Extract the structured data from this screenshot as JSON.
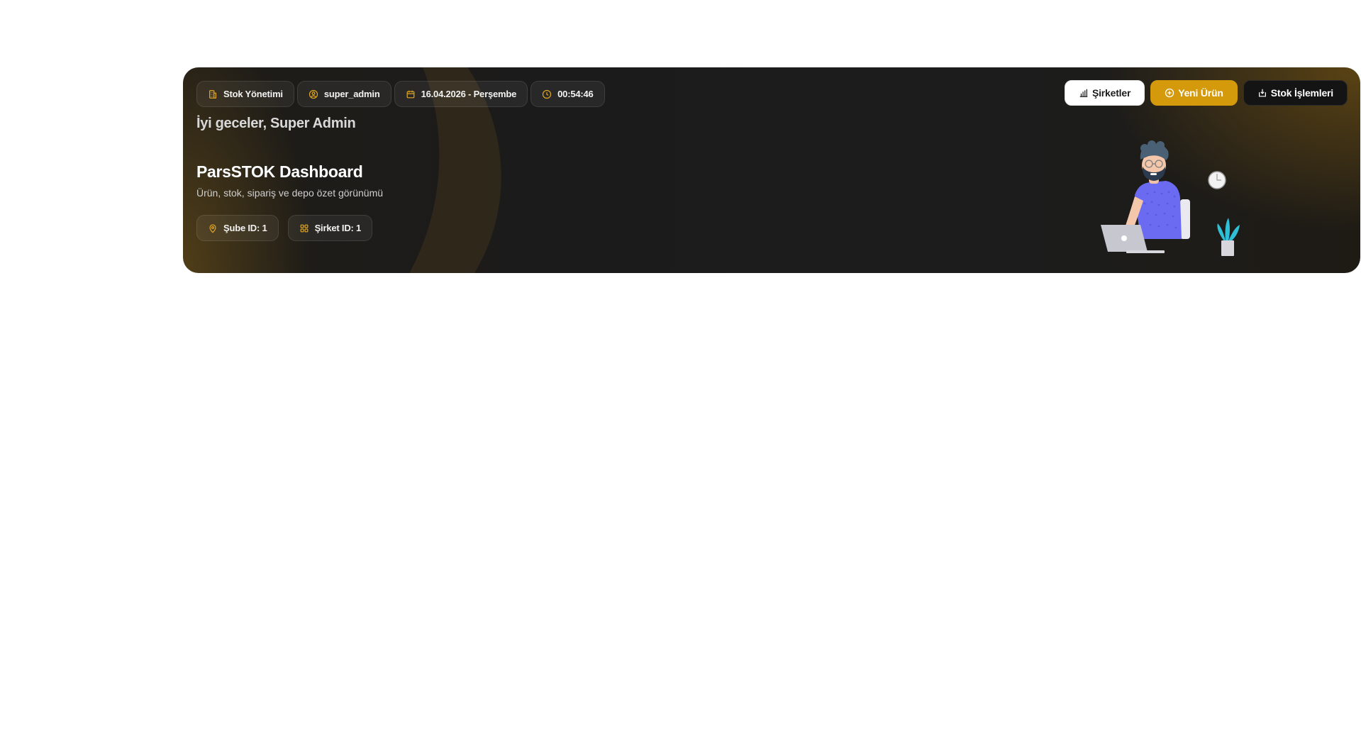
{
  "header": {
    "chips": [
      {
        "icon": "building-icon",
        "label": "Stok Yönetimi"
      },
      {
        "icon": "user-circle-icon",
        "label": "super_admin"
      },
      {
        "icon": "calendar-icon",
        "label": "16.04.2026 - Perşembe"
      },
      {
        "icon": "clock-icon",
        "label": "00:54:46"
      }
    ],
    "greeting": "İyi geceler, Super Admin",
    "title": "ParsSTOK Dashboard",
    "subtitle": "Ürün, stok, sipariş ve depo özet görünümü",
    "info_chips": [
      {
        "icon": "location-pin-icon",
        "label": "Şube ID: 1"
      },
      {
        "icon": "grid-icon",
        "label": "Şirket ID: 1"
      }
    ]
  },
  "actions": {
    "companies": {
      "icon": "bar-chart-icon",
      "label": "Şirketler"
    },
    "new_product": {
      "icon": "plus-circle-icon",
      "label": "Yeni Ürün"
    },
    "stock_ops": {
      "icon": "inbox-down-icon",
      "label": "Stok İşlemleri"
    }
  },
  "colors": {
    "accent": "#d49a0c",
    "hero_background": "#1c1c1c",
    "icon_gold": "#e0a521"
  }
}
